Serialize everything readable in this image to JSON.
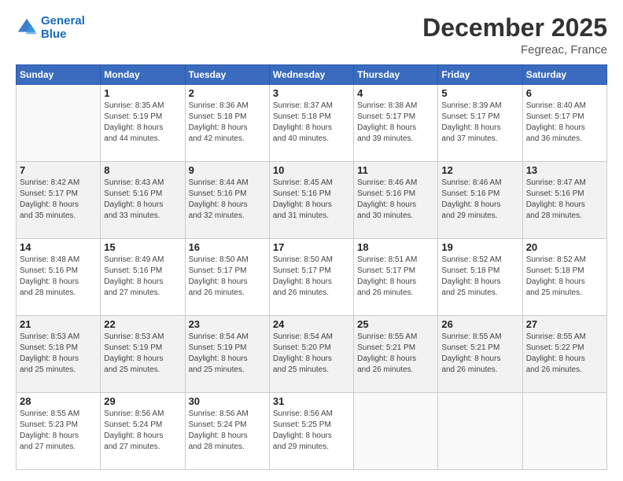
{
  "header": {
    "logo_line1": "General",
    "logo_line2": "Blue",
    "title": "December 2025",
    "subtitle": "Fegreac, France"
  },
  "calendar": {
    "headers": [
      "Sunday",
      "Monday",
      "Tuesday",
      "Wednesday",
      "Thursday",
      "Friday",
      "Saturday"
    ],
    "weeks": [
      [
        {
          "day": "",
          "info": ""
        },
        {
          "day": "1",
          "info": "Sunrise: 8:35 AM\nSunset: 5:19 PM\nDaylight: 8 hours\nand 44 minutes."
        },
        {
          "day": "2",
          "info": "Sunrise: 8:36 AM\nSunset: 5:18 PM\nDaylight: 8 hours\nand 42 minutes."
        },
        {
          "day": "3",
          "info": "Sunrise: 8:37 AM\nSunset: 5:18 PM\nDaylight: 8 hours\nand 40 minutes."
        },
        {
          "day": "4",
          "info": "Sunrise: 8:38 AM\nSunset: 5:17 PM\nDaylight: 8 hours\nand 39 minutes."
        },
        {
          "day": "5",
          "info": "Sunrise: 8:39 AM\nSunset: 5:17 PM\nDaylight: 8 hours\nand 37 minutes."
        },
        {
          "day": "6",
          "info": "Sunrise: 8:40 AM\nSunset: 5:17 PM\nDaylight: 8 hours\nand 36 minutes."
        }
      ],
      [
        {
          "day": "7",
          "info": "Sunrise: 8:42 AM\nSunset: 5:17 PM\nDaylight: 8 hours\nand 35 minutes."
        },
        {
          "day": "8",
          "info": "Sunrise: 8:43 AM\nSunset: 5:16 PM\nDaylight: 8 hours\nand 33 minutes."
        },
        {
          "day": "9",
          "info": "Sunrise: 8:44 AM\nSunset: 5:16 PM\nDaylight: 8 hours\nand 32 minutes."
        },
        {
          "day": "10",
          "info": "Sunrise: 8:45 AM\nSunset: 5:16 PM\nDaylight: 8 hours\nand 31 minutes."
        },
        {
          "day": "11",
          "info": "Sunrise: 8:46 AM\nSunset: 5:16 PM\nDaylight: 8 hours\nand 30 minutes."
        },
        {
          "day": "12",
          "info": "Sunrise: 8:46 AM\nSunset: 5:16 PM\nDaylight: 8 hours\nand 29 minutes."
        },
        {
          "day": "13",
          "info": "Sunrise: 8:47 AM\nSunset: 5:16 PM\nDaylight: 8 hours\nand 28 minutes."
        }
      ],
      [
        {
          "day": "14",
          "info": "Sunrise: 8:48 AM\nSunset: 5:16 PM\nDaylight: 8 hours\nand 28 minutes."
        },
        {
          "day": "15",
          "info": "Sunrise: 8:49 AM\nSunset: 5:16 PM\nDaylight: 8 hours\nand 27 minutes."
        },
        {
          "day": "16",
          "info": "Sunrise: 8:50 AM\nSunset: 5:17 PM\nDaylight: 8 hours\nand 26 minutes."
        },
        {
          "day": "17",
          "info": "Sunrise: 8:50 AM\nSunset: 5:17 PM\nDaylight: 8 hours\nand 26 minutes."
        },
        {
          "day": "18",
          "info": "Sunrise: 8:51 AM\nSunset: 5:17 PM\nDaylight: 8 hours\nand 26 minutes."
        },
        {
          "day": "19",
          "info": "Sunrise: 8:52 AM\nSunset: 5:18 PM\nDaylight: 8 hours\nand 25 minutes."
        },
        {
          "day": "20",
          "info": "Sunrise: 8:52 AM\nSunset: 5:18 PM\nDaylight: 8 hours\nand 25 minutes."
        }
      ],
      [
        {
          "day": "21",
          "info": "Sunrise: 8:53 AM\nSunset: 5:18 PM\nDaylight: 8 hours\nand 25 minutes."
        },
        {
          "day": "22",
          "info": "Sunrise: 8:53 AM\nSunset: 5:19 PM\nDaylight: 8 hours\nand 25 minutes."
        },
        {
          "day": "23",
          "info": "Sunrise: 8:54 AM\nSunset: 5:19 PM\nDaylight: 8 hours\nand 25 minutes."
        },
        {
          "day": "24",
          "info": "Sunrise: 8:54 AM\nSunset: 5:20 PM\nDaylight: 8 hours\nand 25 minutes."
        },
        {
          "day": "25",
          "info": "Sunrise: 8:55 AM\nSunset: 5:21 PM\nDaylight: 8 hours\nand 26 minutes."
        },
        {
          "day": "26",
          "info": "Sunrise: 8:55 AM\nSunset: 5:21 PM\nDaylight: 8 hours\nand 26 minutes."
        },
        {
          "day": "27",
          "info": "Sunrise: 8:55 AM\nSunset: 5:22 PM\nDaylight: 8 hours\nand 26 minutes."
        }
      ],
      [
        {
          "day": "28",
          "info": "Sunrise: 8:55 AM\nSunset: 5:23 PM\nDaylight: 8 hours\nand 27 minutes."
        },
        {
          "day": "29",
          "info": "Sunrise: 8:56 AM\nSunset: 5:24 PM\nDaylight: 8 hours\nand 27 minutes."
        },
        {
          "day": "30",
          "info": "Sunrise: 8:56 AM\nSunset: 5:24 PM\nDaylight: 8 hours\nand 28 minutes."
        },
        {
          "day": "31",
          "info": "Sunrise: 8:56 AM\nSunset: 5:25 PM\nDaylight: 8 hours\nand 29 minutes."
        },
        {
          "day": "",
          "info": ""
        },
        {
          "day": "",
          "info": ""
        },
        {
          "day": "",
          "info": ""
        }
      ]
    ]
  }
}
